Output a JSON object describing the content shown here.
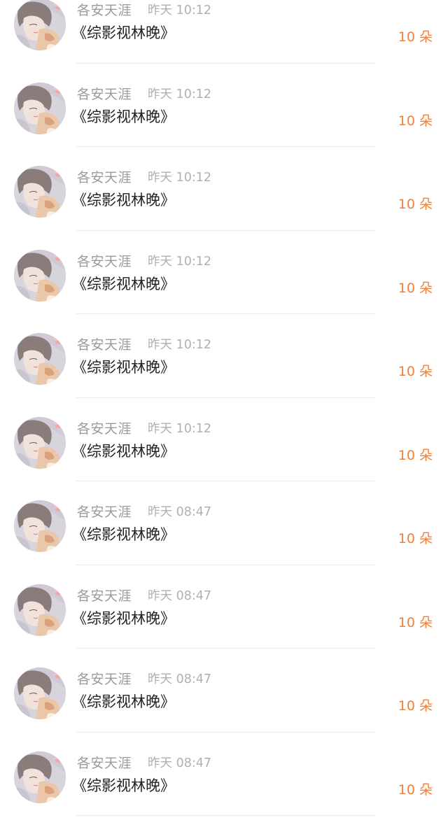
{
  "accent_color": "#f0813a",
  "avatar_icon": "user-avatar-illustration",
  "items": [
    {
      "name": "各安天涯",
      "time": "昨天 10:12",
      "book": "《综影视林晚》",
      "count": "10 朵"
    },
    {
      "name": "各安天涯",
      "time": "昨天 10:12",
      "book": "《综影视林晚》",
      "count": "10 朵"
    },
    {
      "name": "各安天涯",
      "time": "昨天 10:12",
      "book": "《综影视林晚》",
      "count": "10 朵"
    },
    {
      "name": "各安天涯",
      "time": "昨天 10:12",
      "book": "《综影视林晚》",
      "count": "10 朵"
    },
    {
      "name": "各安天涯",
      "time": "昨天 10:12",
      "book": "《综影视林晚》",
      "count": "10 朵"
    },
    {
      "name": "各安天涯",
      "time": "昨天 10:12",
      "book": "《综影视林晚》",
      "count": "10 朵"
    },
    {
      "name": "各安天涯",
      "time": "昨天 08:47",
      "book": "《综影视林晚》",
      "count": "10 朵"
    },
    {
      "name": "各安天涯",
      "time": "昨天 08:47",
      "book": "《综影视林晚》",
      "count": "10 朵"
    },
    {
      "name": "各安天涯",
      "time": "昨天 08:47",
      "book": "《综影视林晚》",
      "count": "10 朵"
    },
    {
      "name": "各安天涯",
      "time": "昨天 08:47",
      "book": "《综影视林晚》",
      "count": "10 朵"
    }
  ]
}
